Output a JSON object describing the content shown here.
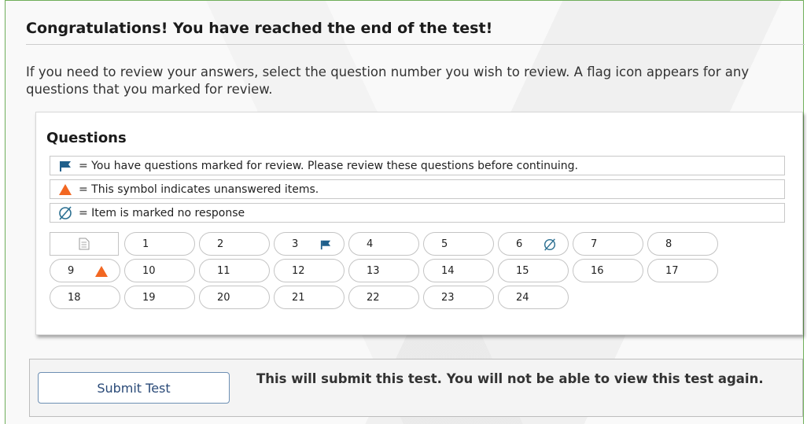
{
  "heading": "Congratulations! You have reached the end of the test!",
  "instructions": "If you need to review your answers, select the question number you wish to review. A flag icon appears for any questions that you marked for review.",
  "questions_panel": {
    "title": "Questions",
    "legend": [
      {
        "icon": "flag-icon",
        "text": "= You have questions marked for review. Please review these questions before continuing."
      },
      {
        "icon": "warning-triangle-icon",
        "text": "= This symbol indicates unanswered items."
      },
      {
        "icon": "no-response-icon",
        "text": "= Item is marked no response"
      }
    ],
    "items": [
      {
        "number": "1",
        "status": ""
      },
      {
        "number": "2",
        "status": ""
      },
      {
        "number": "3",
        "status": "flagged"
      },
      {
        "number": "4",
        "status": ""
      },
      {
        "number": "5",
        "status": ""
      },
      {
        "number": "6",
        "status": "no-response"
      },
      {
        "number": "7",
        "status": ""
      },
      {
        "number": "8",
        "status": ""
      },
      {
        "number": "9",
        "status": "unanswered"
      },
      {
        "number": "10",
        "status": ""
      },
      {
        "number": "11",
        "status": ""
      },
      {
        "number": "12",
        "status": ""
      },
      {
        "number": "13",
        "status": ""
      },
      {
        "number": "14",
        "status": ""
      },
      {
        "number": "15",
        "status": ""
      },
      {
        "number": "16",
        "status": ""
      },
      {
        "number": "17",
        "status": ""
      },
      {
        "number": "18",
        "status": ""
      },
      {
        "number": "19",
        "status": ""
      },
      {
        "number": "20",
        "status": ""
      },
      {
        "number": "21",
        "status": ""
      },
      {
        "number": "22",
        "status": ""
      },
      {
        "number": "23",
        "status": ""
      },
      {
        "number": "24",
        "status": ""
      }
    ]
  },
  "submit": {
    "button_label": "Submit Test",
    "message": "This will submit this test. You will not be able to view this test again."
  },
  "colors": {
    "flag": "#1f5f8b",
    "warning": "#f26722",
    "no_response": "#2b6f91",
    "frame_border": "#6fae5a"
  }
}
